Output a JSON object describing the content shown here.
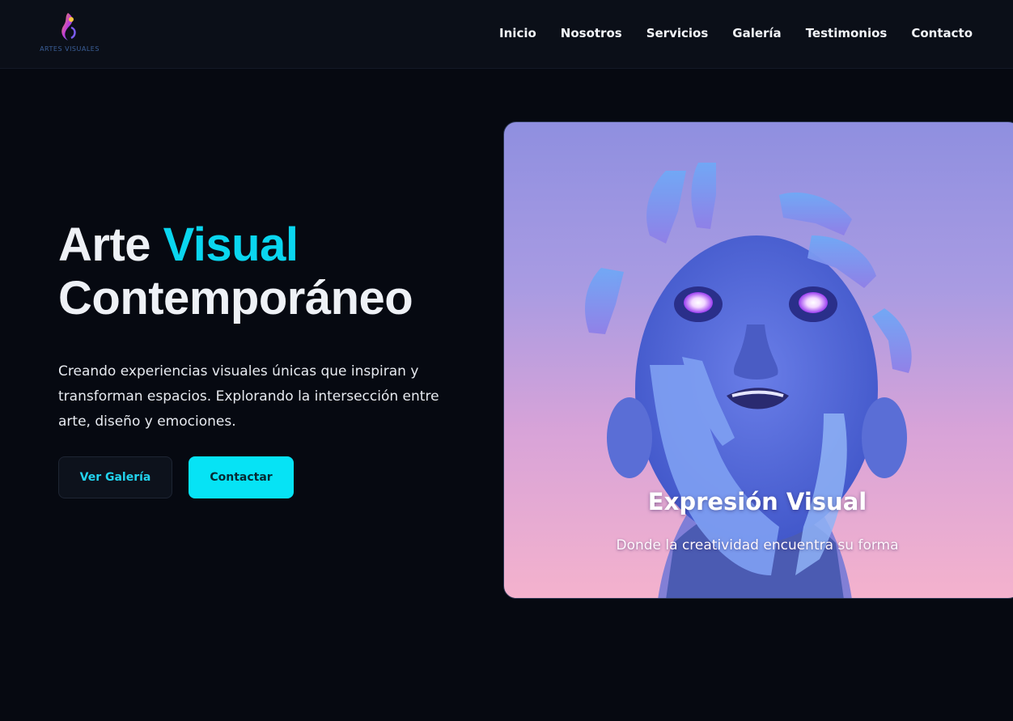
{
  "brand": {
    "logo_text": "ARTES VISUALES",
    "accent_color": "#0ad6ef"
  },
  "nav": {
    "items": [
      {
        "label": "Inicio"
      },
      {
        "label": "Nosotros"
      },
      {
        "label": "Servicios"
      },
      {
        "label": "Galería"
      },
      {
        "label": "Testimonios"
      },
      {
        "label": "Contacto"
      }
    ]
  },
  "hero": {
    "title_part1": "Arte ",
    "title_accent": "Visual",
    "title_part2": "Contemporáneo",
    "description": "Creando experiencias visuales únicas que inspiran y transforman espacios. Explorando la intersección entre arte, diseño y emociones.",
    "buttons": {
      "gallery_label": "Ver Galería",
      "contact_label": "Contactar"
    }
  },
  "card": {
    "title": "Expresión Visual",
    "subtitle": "Donde la creatividad encuentra su forma",
    "image_subject": "surreal-blue-face-with-hands"
  }
}
